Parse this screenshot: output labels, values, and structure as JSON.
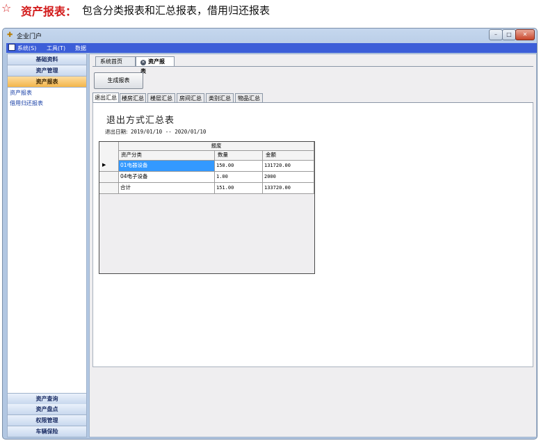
{
  "caption": {
    "star": "☆",
    "heading": "资产报表：",
    "description": "包含分类报表和汇总报表，借用归还报表"
  },
  "window": {
    "title": "企业门户",
    "controls": [
      "–",
      "□",
      "✕"
    ]
  },
  "menubar": [
    {
      "label": "系统(S)"
    },
    {
      "label": "工具(T)"
    },
    {
      "label": "数据"
    }
  ],
  "leftnav": {
    "top_sections": [
      "基础资料",
      "资产管理",
      "资产报表"
    ],
    "active_section": "资产报表",
    "links": [
      "资产报表",
      "借用归还报表"
    ],
    "bottom_sections": [
      "资产查询",
      "资产盘点",
      "权限管理",
      "车辆保险"
    ]
  },
  "tabs": [
    {
      "label": "系统首页"
    },
    {
      "label": "资产报表"
    }
  ],
  "toolbar": {
    "generate_label": "生成报表"
  },
  "subtabs": [
    "退出汇总",
    "楼房汇总",
    "楼层汇总",
    "房间汇总",
    "类别汇总",
    "物品汇总"
  ],
  "report": {
    "title": "退出方式汇总表",
    "date_label": "退出日期:",
    "date_from": "2019/01/10",
    "date_sep": "--",
    "date_to": "2020/01/10"
  },
  "grid": {
    "group_header": "报废",
    "columns": [
      "资产分类",
      "数量",
      "金额"
    ],
    "rows": [
      {
        "category": "01电器设备",
        "qty": "150.00",
        "amount": "131720.00",
        "selected": true
      },
      {
        "category": "04电子设备",
        "qty": "1.00",
        "amount": "2000",
        "selected": false
      },
      {
        "category": "合计",
        "qty": "151.00",
        "amount": "133720.00",
        "selected": false
      }
    ],
    "row_indicator": "▶"
  },
  "colors": {
    "menubar": "#3c5ed8",
    "active_nav": "#f3b54a",
    "selection": "#3399ff",
    "caption_red": "#d21a1a"
  }
}
